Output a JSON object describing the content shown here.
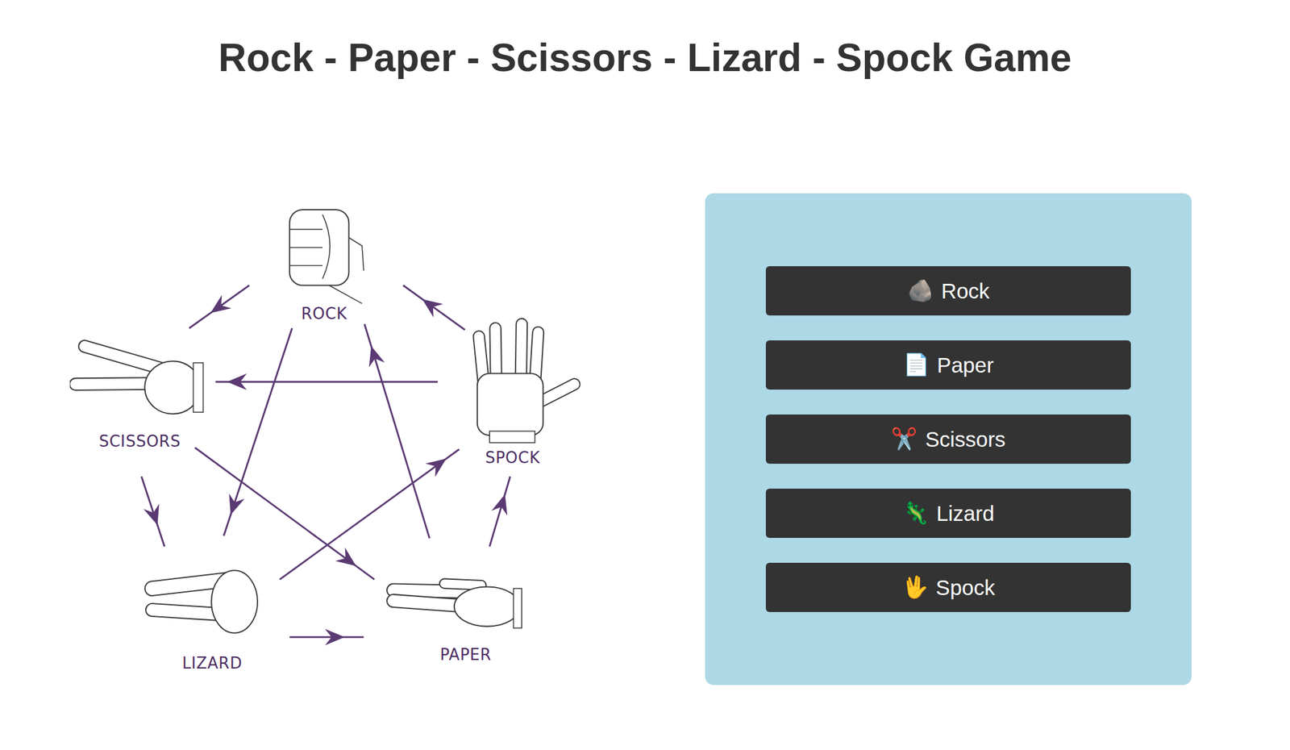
{
  "title": "Rock - Paper - Scissors - Lizard - Spock Game",
  "diagram": {
    "nodes": [
      {
        "label": "ROCK",
        "beats": [
          "SCISSORS",
          "LIZARD"
        ]
      },
      {
        "label": "SPOCK",
        "beats": [
          "ROCK",
          "SCISSORS"
        ]
      },
      {
        "label": "PAPER",
        "beats": [
          "ROCK",
          "SPOCK"
        ]
      },
      {
        "label": "LIZARD",
        "beats": [
          "PAPER",
          "SPOCK"
        ]
      },
      {
        "label": "SCISSORS",
        "beats": [
          "LIZARD",
          "PAPER"
        ]
      }
    ]
  },
  "buttons": [
    {
      "icon": "🪨",
      "label": "Rock"
    },
    {
      "icon": "📄",
      "label": "Paper"
    },
    {
      "icon": "✂️",
      "label": "Scissors"
    },
    {
      "icon": "🦎",
      "label": "Lizard"
    },
    {
      "icon": "🖖",
      "label": "Spock"
    }
  ]
}
